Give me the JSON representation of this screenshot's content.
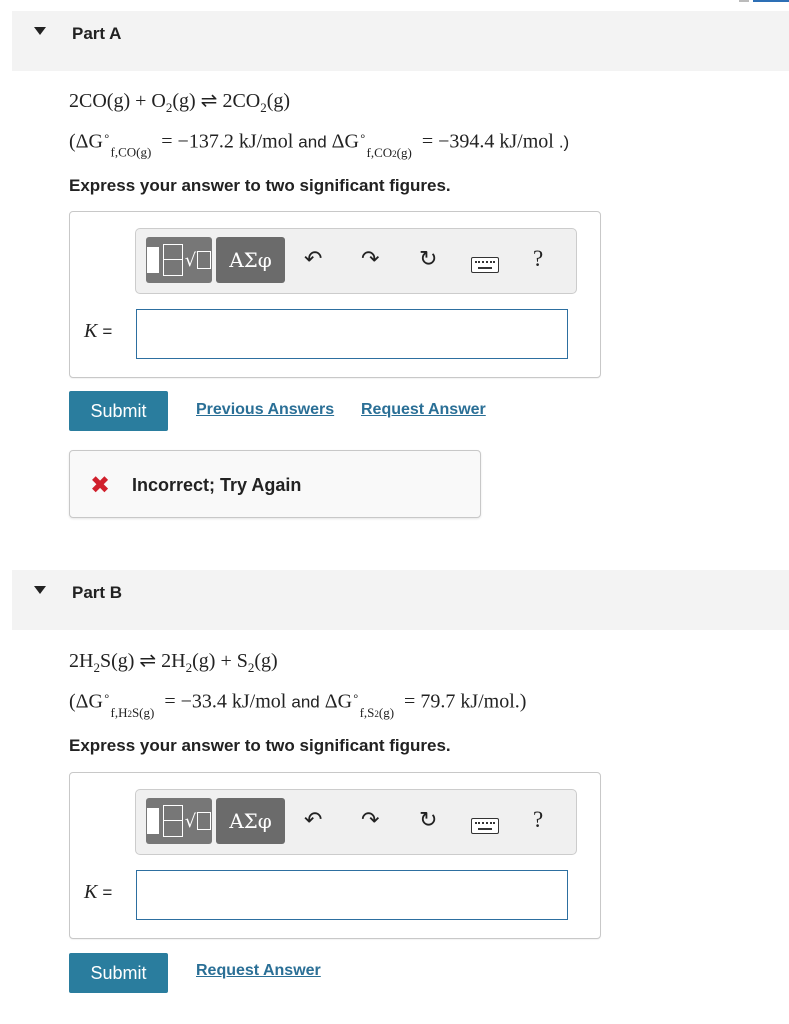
{
  "part_a": {
    "title": "Part A",
    "reaction": {
      "r1": "2CO(g)",
      "plus": "+",
      "r2": "O",
      "r2_sub": "2",
      "r2_state": "(g)",
      "arrow": "⇌",
      "p1": "2CO",
      "p1_sub": "2",
      "p1_state": "(g)"
    },
    "given": {
      "open": "(ΔG",
      "sup": "∘",
      "sub1": "f,CO(g)",
      "val1": "= −137.2 kJ/mol",
      "and": "and",
      "delta2": "ΔG",
      "sub2a": "f,CO",
      "sub2b": "2",
      "sub2c": "(g)",
      "val2": "= −394.4 kJ/mol",
      "close": ".)"
    },
    "instruction": "Express your answer to two significant figures.",
    "answer_label": "K",
    "answer_eq": "=",
    "answer_value": "",
    "submit_label": "Submit",
    "links": [
      "Previous Answers",
      "Request Answer"
    ],
    "feedback": "Incorrect; Try Again"
  },
  "part_b": {
    "title": "Part B",
    "reaction": {
      "r1": "2H",
      "r1_sub": "2",
      "r1_rest": "S(g)",
      "arrow": "⇌",
      "p1": "2H",
      "p1_sub": "2",
      "p1_state": "(g)",
      "plus": "+",
      "p2": "S",
      "p2_sub": "2",
      "p2_state": "(g)"
    },
    "given": {
      "open": "(ΔG",
      "sup": "∘",
      "sub1a": "f,H",
      "sub1b": "2",
      "sub1c": "S(g)",
      "val1": "= −33.4 kJ/mol",
      "and": "and",
      "delta2": "ΔG",
      "sub2a": "f,S",
      "sub2b": "2",
      "sub2c": "(g)",
      "val2": "= 79.7 kJ/mol.)"
    },
    "instruction": "Express your answer to two significant figures.",
    "answer_label": "K",
    "answer_eq": "=",
    "answer_value": "",
    "submit_label": "Submit",
    "links": [
      "Request Answer"
    ]
  },
  "toolbar": {
    "greek_label": "ΑΣφ",
    "undo_icon": "undo-icon",
    "redo_icon": "redo-icon",
    "reset_icon": "reset-icon",
    "keyboard_icon": "keyboard-icon",
    "help_label": "?"
  },
  "colors": {
    "submit_bg": "#2a7d9e",
    "link": "#2a6f96",
    "error": "#d0202c",
    "header_bg": "#f3f3f3"
  }
}
